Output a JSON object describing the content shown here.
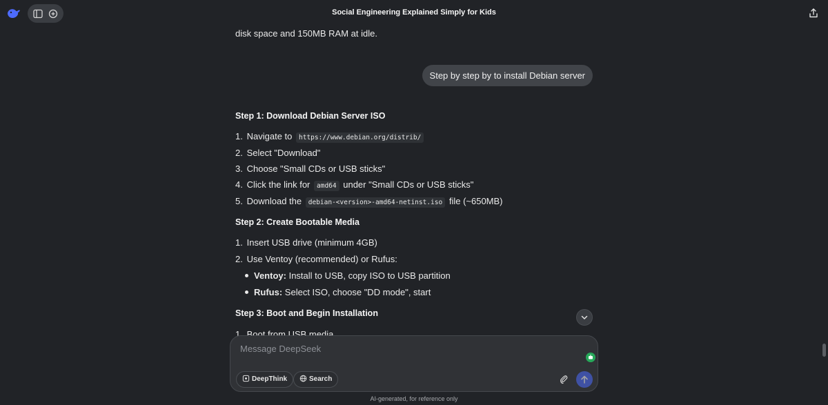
{
  "header": {
    "title": "Social Engineering Explained Simply for Kids",
    "logo_icon": "whale-logo-icon",
    "accent_color": "#4d6bfe"
  },
  "conversation": {
    "prev_text": "disk space and 150MB RAM at idle.",
    "user_message": "Step by step by to install Debian server",
    "step1": {
      "heading": "Step 1: Download Debian Server ISO",
      "items": [
        {
          "num": "1.",
          "pre": "Navigate to",
          "code": "https://www.debian.org/distrib/",
          "post": ""
        },
        {
          "num": "2.",
          "pre": "Select \"Download\"",
          "code": "",
          "post": ""
        },
        {
          "num": "3.",
          "pre": "Choose \"Small CDs or USB sticks\"",
          "code": "",
          "post": ""
        },
        {
          "num": "4.",
          "pre": "Click the link for",
          "code": "amd64",
          "post": "under \"Small CDs or USB sticks\""
        },
        {
          "num": "5.",
          "pre": "Download the",
          "code": "debian-<version>-amd64-netinst.iso",
          "post": "file (~650MB)"
        }
      ]
    },
    "step2": {
      "heading": "Step 2: Create Bootable Media",
      "items": [
        {
          "num": "1.",
          "text": "Insert USB drive (minimum 4GB)"
        },
        {
          "num": "2.",
          "text": "Use Ventoy (recommended) or Rufus:"
        }
      ],
      "bullets": [
        {
          "bold": "Ventoy:",
          "text": "Install to USB, copy ISO to USB partition"
        },
        {
          "bold": "Rufus:",
          "text": "Select ISO, choose \"DD mode\", start"
        }
      ]
    },
    "step3": {
      "heading": "Step 3: Boot and Begin Installation",
      "items": [
        {
          "num": "1.",
          "text": "Boot from USB media"
        }
      ]
    }
  },
  "composer": {
    "placeholder": "Message DeepSeek",
    "deepthink_label": "DeepThink",
    "search_label": "Search"
  },
  "footer": {
    "disclaimer": "AI-generated, for reference only"
  }
}
